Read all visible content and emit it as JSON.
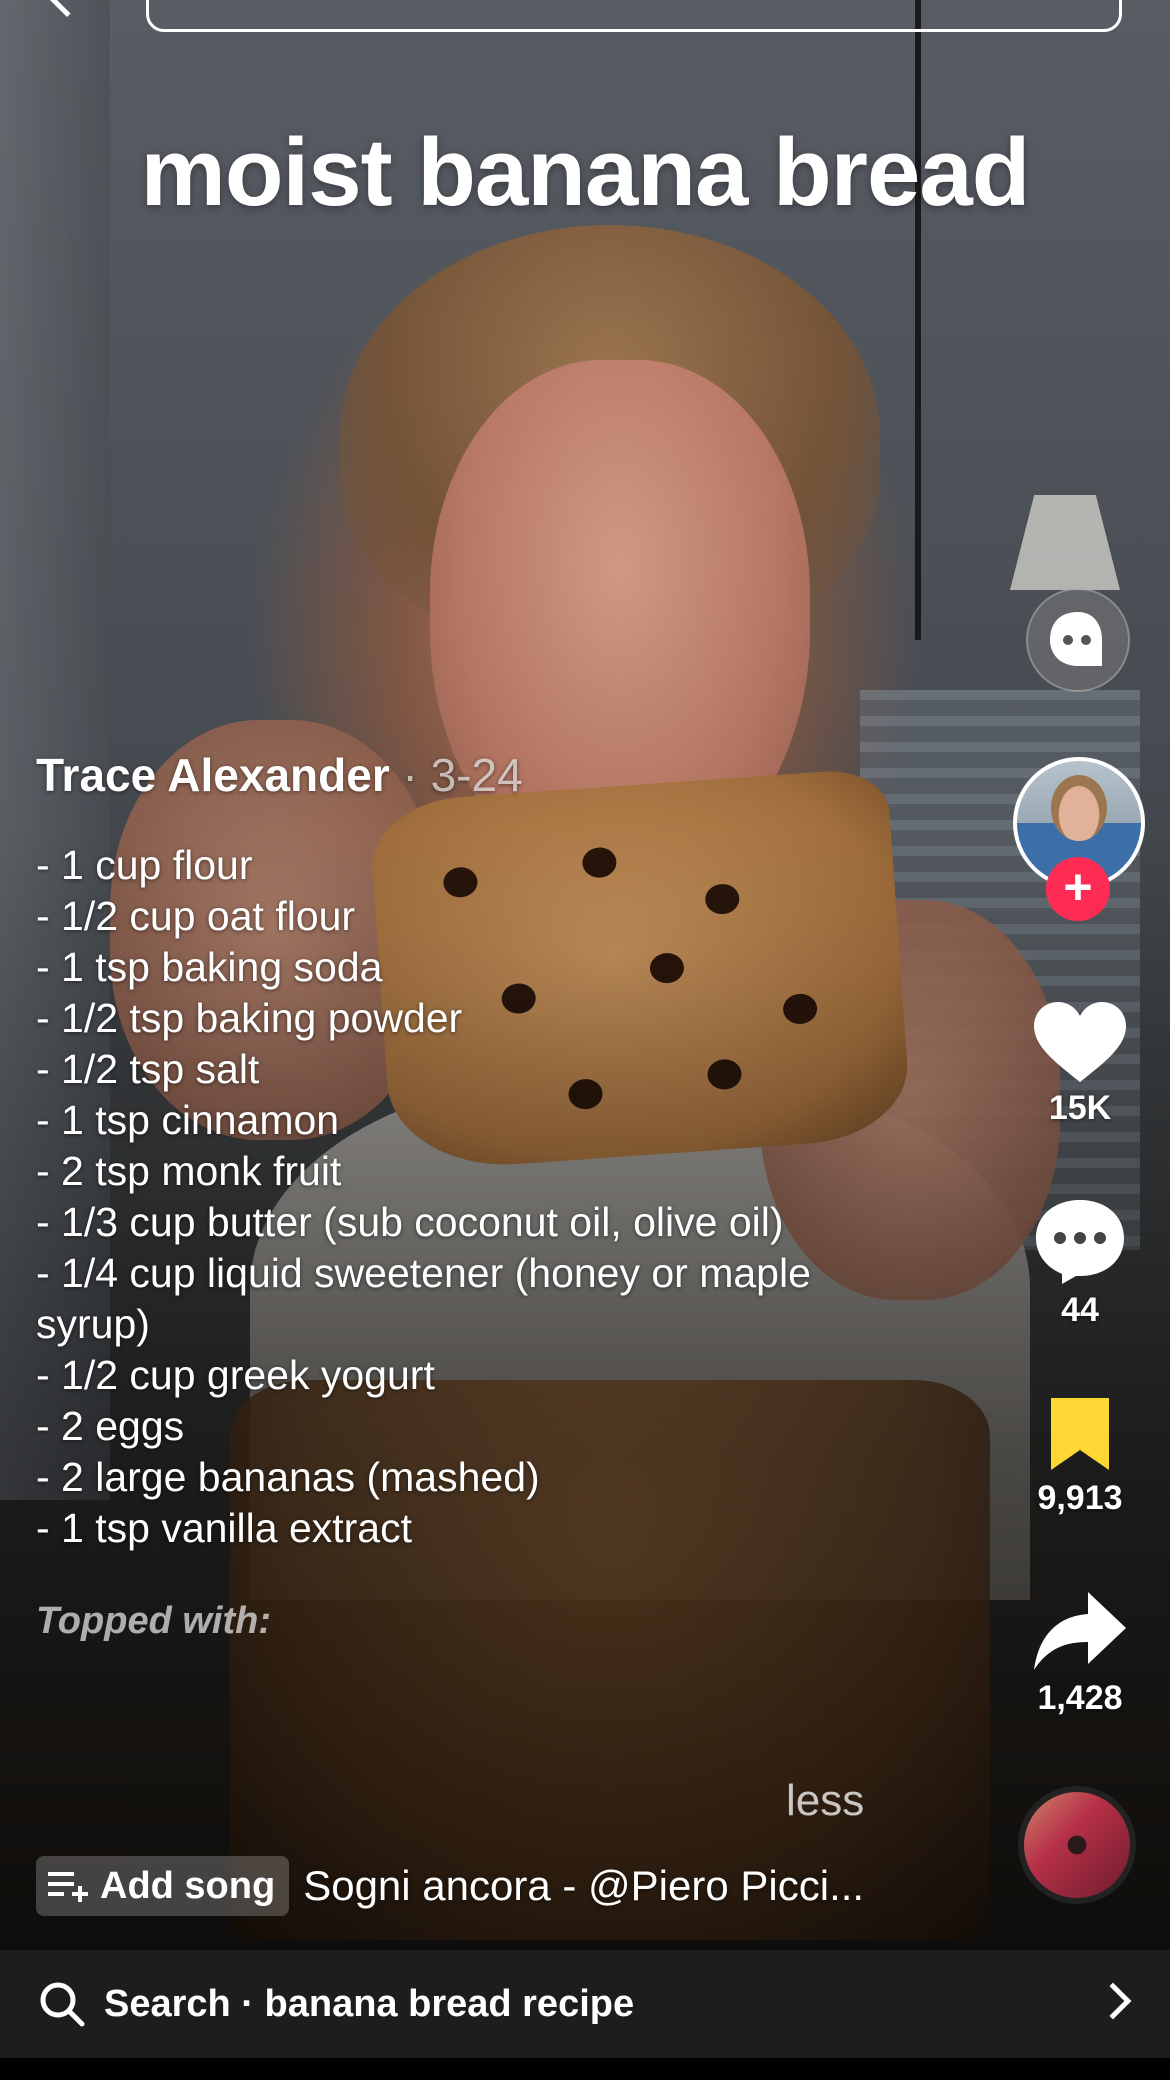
{
  "video": {
    "caption": "moist banana bread"
  },
  "author": {
    "name": "Trace Alexander",
    "date": " · 3-24"
  },
  "description": {
    "ingredients": [
      "- 1 cup flour",
      "- 1/2 cup oat flour",
      "- 1 tsp baking soda",
      "- 1/2 tsp baking powder",
      "- 1/2 tsp salt",
      "- 1 tsp cinnamon",
      "- 2 tsp monk fruit",
      "- 1/3 cup butter (sub coconut oil, olive oil)",
      "- 1/4 cup liquid sweetener (honey or maple syrup)",
      "- 1/2 cup greek yogurt",
      "- 2 eggs",
      "- 2 large bananas (mashed)",
      "- 1 tsp vanilla extract"
    ],
    "topped_with": "Topped with:",
    "less_label": "less"
  },
  "actions": {
    "likes": "15K",
    "comments": "44",
    "saves": "9,913",
    "shares": "1,428"
  },
  "music": {
    "add_song_label": "Add song",
    "track": "Sogni ancora - @Piero Picci..."
  },
  "bottom_search": {
    "label": "Search · banana bread recipe"
  },
  "colors": {
    "follow_accent": "#fe2c55",
    "bookmark": "#fdd835",
    "bottom_bar": "#1d1d1f"
  },
  "icons": [
    "back-icon",
    "ai-assistant-icon",
    "heart-icon",
    "comment-icon",
    "bookmark-icon",
    "share-icon",
    "add-song-icon",
    "search-icon",
    "chevron-right-icon"
  ]
}
